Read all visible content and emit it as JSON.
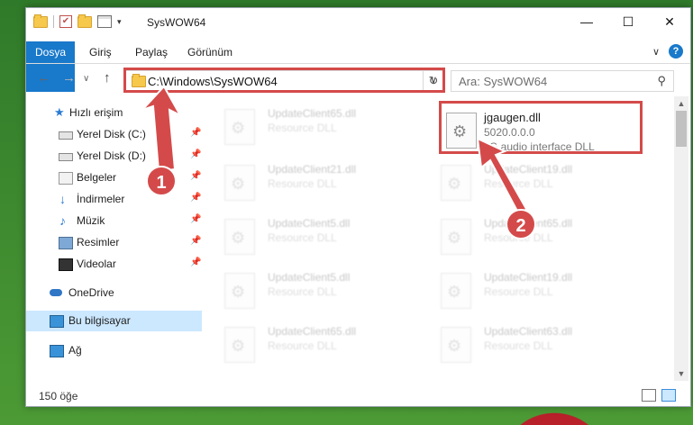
{
  "window": {
    "title": "SysWOW64",
    "controls": {
      "minimize": "—",
      "maximize": "☐",
      "close": "✕"
    }
  },
  "ribbon": {
    "tabs": [
      "Dosya",
      "Giriş",
      "Paylaş",
      "Görünüm"
    ],
    "help": "?"
  },
  "nav": {
    "address": "C:\\Windows\\SysWOW64",
    "search_placeholder": "Ara: SysWOW64"
  },
  "sidebar": {
    "quick_access": "Hızlı erişim",
    "items": [
      {
        "label": "Yerel Disk (C:)",
        "icon": "drive-icon",
        "pinned": true
      },
      {
        "label": "Yerel Disk (D:)",
        "icon": "drive-icon",
        "pinned": true
      },
      {
        "label": "Belgeler",
        "icon": "documents-icon",
        "pinned": true
      },
      {
        "label": "İndirmeler",
        "icon": "downloads-icon",
        "pinned": true
      },
      {
        "label": "Müzik",
        "icon": "music-icon",
        "pinned": true
      },
      {
        "label": "Resimler",
        "icon": "pictures-icon",
        "pinned": true
      },
      {
        "label": "Videolar",
        "icon": "videos-icon",
        "pinned": true
      }
    ],
    "onedrive": "OneDrive",
    "this_pc": "Bu bilgisayar",
    "network": "Ağ"
  },
  "files": {
    "highlighted": {
      "name": "jgaugen.dll",
      "version": "5020.0.0.0",
      "description": "JG audio interface DLL"
    },
    "faded": [
      {
        "name": "UpdateClient65.dll",
        "sub": "Resource DLL"
      },
      {
        "name": "UpdateClient21.dll",
        "sub": "Resource DLL"
      },
      {
        "name": "UpdateClient19.dll",
        "sub": "Resource DLL"
      },
      {
        "name": "UpdateClient5.dll",
        "sub": "Resource DLL"
      },
      {
        "name": "UpdateClient65.dll",
        "sub": "Resource DLL"
      },
      {
        "name": "UpdateClient5.dll",
        "sub": "Resource DLL"
      },
      {
        "name": "UpdateClient19.dll",
        "sub": "Resource DLL"
      },
      {
        "name": "UpdateClient65.dll",
        "sub": "Resource DLL"
      },
      {
        "name": "UpdateClient63.dll",
        "sub": "Resource DLL"
      }
    ]
  },
  "status": {
    "count": "150 öğe"
  },
  "annotations": {
    "step1": "1",
    "step2": "2"
  },
  "colors": {
    "accent": "#1979ca",
    "highlight": "#d44a4a",
    "selected": "#cce8ff"
  }
}
